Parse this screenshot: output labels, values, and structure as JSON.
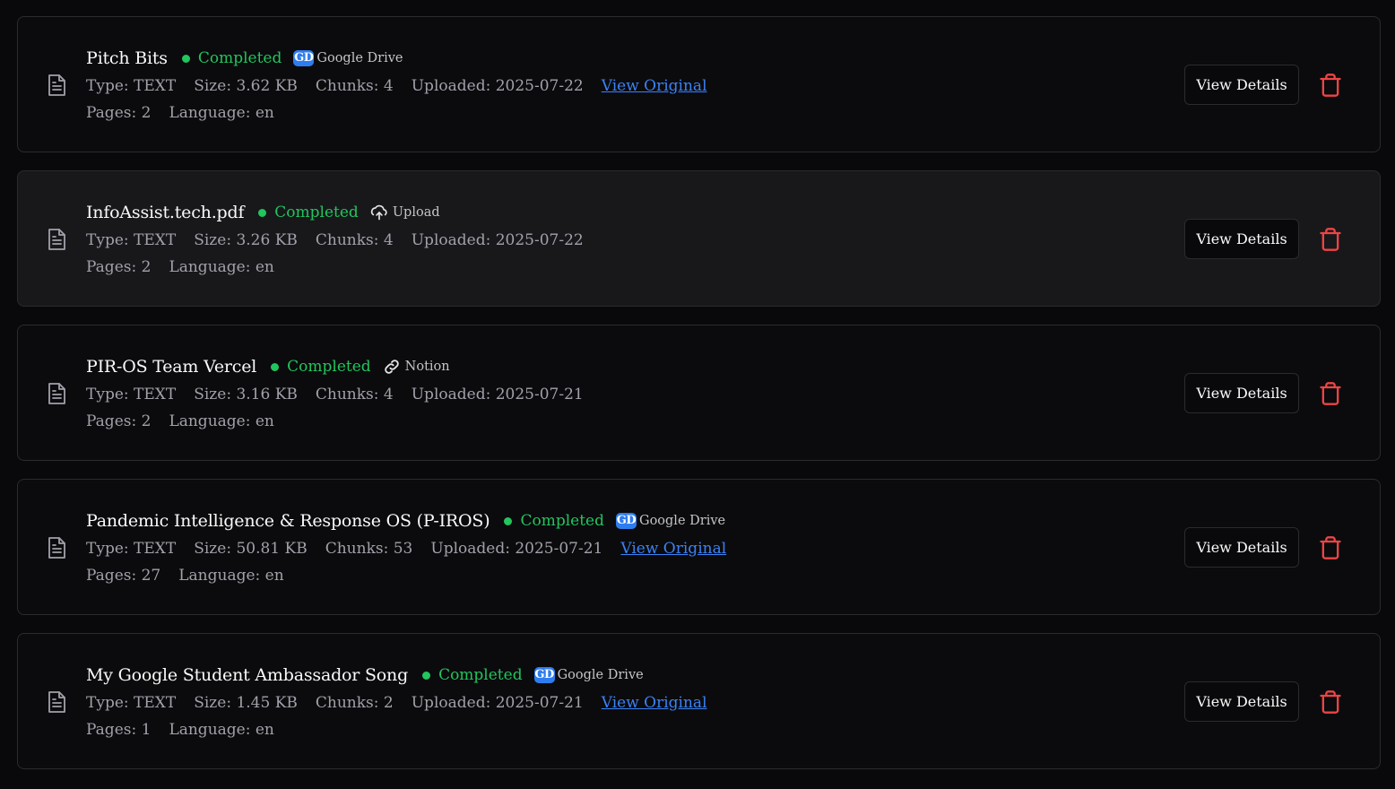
{
  "documents": [
    {
      "title": "Pitch Bits",
      "status": "Completed",
      "source": {
        "label": "Google Drive",
        "badge": "GD",
        "icon": "google-drive-icon"
      },
      "type": "Type: TEXT",
      "size": "Size: 3.62 KB",
      "chunks": "Chunks: 4",
      "uploaded": "Uploaded: 2025-07-22",
      "link": "View Original",
      "pages": "Pages: 2",
      "language": "Language: en",
      "details_label": "View Details"
    },
    {
      "title": "InfoAssist.tech.pdf",
      "status": "Completed",
      "source": {
        "label": "Upload",
        "icon": "cloud-upload-icon"
      },
      "type": "Type: TEXT",
      "size": "Size: 3.26 KB",
      "chunks": "Chunks: 4",
      "uploaded": "Uploaded: 2025-07-22",
      "pages": "Pages: 2",
      "language": "Language: en",
      "details_label": "View Details"
    },
    {
      "title": "PIR-OS Team Vercel",
      "status": "Completed",
      "source": {
        "label": "Notion",
        "icon": "link-icon"
      },
      "type": "Type: TEXT",
      "size": "Size: 3.16 KB",
      "chunks": "Chunks: 4",
      "uploaded": "Uploaded: 2025-07-21",
      "pages": "Pages: 2",
      "language": "Language: en",
      "details_label": "View Details"
    },
    {
      "title": "Pandemic Intelligence & Response OS (P-IROS)",
      "status": "Completed",
      "source": {
        "label": "Google Drive",
        "badge": "GD",
        "icon": "google-drive-icon"
      },
      "type": "Type: TEXT",
      "size": "Size: 50.81 KB",
      "chunks": "Chunks: 53",
      "uploaded": "Uploaded: 2025-07-21",
      "link": "View Original",
      "pages": "Pages: 27",
      "language": "Language: en",
      "details_label": "View Details"
    },
    {
      "title": "My Google Student Ambassador Song",
      "status": "Completed",
      "source": {
        "label": "Google Drive",
        "badge": "GD",
        "icon": "google-drive-icon"
      },
      "type": "Type: TEXT",
      "size": "Size: 1.45 KB",
      "chunks": "Chunks: 2",
      "uploaded": "Uploaded: 2025-07-21",
      "link": "View Original",
      "pages": "Pages: 1",
      "language": "Language: en",
      "details_label": "View Details"
    }
  ],
  "colors": {
    "status_green": "#22c55e",
    "link_blue": "#3b82f6",
    "delete_red": "#ef4444",
    "drive_blue": "#2e7df0"
  }
}
